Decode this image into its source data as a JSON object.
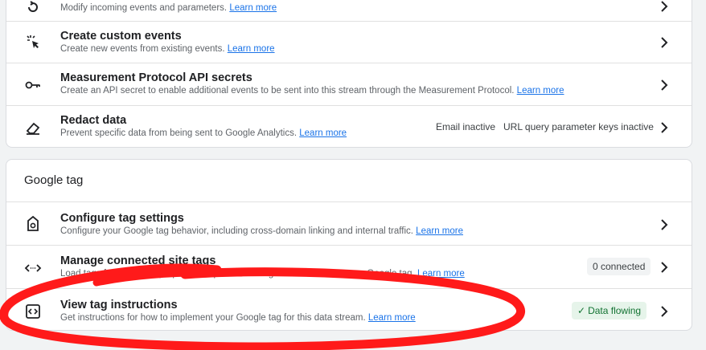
{
  "card1": {
    "rows": [
      {
        "title": "",
        "desc": "Modify incoming events and parameters.",
        "link": "Learn more",
        "icon": "modify-events-icon"
      },
      {
        "title": "Create custom events",
        "desc": "Create new events from existing events.",
        "link": "Learn more",
        "icon": "sparkle-cursor-icon"
      },
      {
        "title": "Measurement Protocol API secrets",
        "desc": "Create an API secret to enable additional events to be sent into this stream through the Measurement Protocol.",
        "link": "Learn more",
        "icon": "key-icon"
      },
      {
        "title": "Redact data",
        "desc": "Prevent specific data from being sent to Google Analytics.",
        "link": "Learn more",
        "icon": "eraser-icon",
        "status1": "Email inactive",
        "status2": "URL query parameter keys inactive"
      }
    ]
  },
  "card2": {
    "header": "Google tag",
    "rows": [
      {
        "title": "Configure tag settings",
        "desc": "Configure your Google tag behavior, including cross-domain linking and internal traffic.",
        "link": "Learn more",
        "icon": "tag-icon"
      },
      {
        "title": "Manage connected site tags",
        "desc": "Load tags for additional properties or products using this stream's on-page Google tag.",
        "link": "Learn more",
        "icon": "code-arrows-icon",
        "badge": "0 connected"
      },
      {
        "title": "View tag instructions",
        "desc": "Get instructions for how to implement your Google tag for this data stream.",
        "link": "Learn more",
        "icon": "code-box-icon",
        "badge": "Data flowing",
        "badge_icon": "checkmark-icon"
      }
    ]
  },
  "colors": {
    "link": "#1a73e8",
    "annotation": "#ff1a1a",
    "success_bg": "#e6f4ea",
    "success_text": "#137333"
  }
}
